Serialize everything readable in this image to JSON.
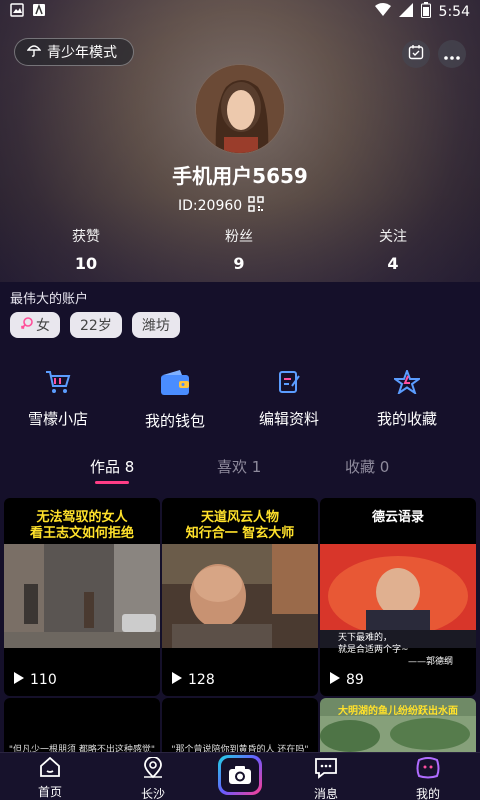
{
  "status_bar": {
    "time": "5:54"
  },
  "header": {
    "teen_mode_label": "青少年模式",
    "username": "手机用户5659",
    "user_id": "ID:20960",
    "stats": [
      {
        "label": "获赞",
        "value": "10"
      },
      {
        "label": "粉丝",
        "value": "9"
      },
      {
        "label": "关注",
        "value": "4"
      }
    ]
  },
  "profile": {
    "bio": "最伟大的账户",
    "tags": {
      "gender": "女",
      "age": "22岁",
      "city": "潍坊"
    }
  },
  "shortcuts": [
    {
      "label": "雪檬小店",
      "icon": "shopping-cart-icon"
    },
    {
      "label": "我的钱包",
      "icon": "wallet-icon"
    },
    {
      "label": "编辑资料",
      "icon": "edit-icon"
    },
    {
      "label": "我的收藏",
      "icon": "star-icon"
    }
  ],
  "tabs": [
    {
      "label": "作品 8"
    },
    {
      "label": "喜欢 1"
    },
    {
      "label": "收藏 0"
    }
  ],
  "videos": [
    {
      "title_line1": "无法驾驭的女人",
      "title_line2": "看王志文如何拒绝",
      "plays": "110"
    },
    {
      "title_line1": "天道风云人物",
      "title_line2": "知行合一  智玄大师",
      "plays": "128"
    },
    {
      "title_line1": "德云语录",
      "caption_line1": "天下最难的，",
      "caption_line2": "就是合适两个字~",
      "caption_author": "——郭德纲",
      "plays": "89"
    }
  ],
  "videos_row2": [
    {
      "caption": "\"但凡少一根朋须  都略不出这种感觉\""
    },
    {
      "caption": "\"那个曾说陪你到黄昏的人  还在吗\""
    },
    {
      "title": "大明湖的鱼儿纷纷跃出水面"
    }
  ],
  "bottom_nav": [
    {
      "label": "首页",
      "icon": "home-icon"
    },
    {
      "label": "长沙",
      "icon": "location-icon"
    },
    {
      "label": "消息",
      "icon": "message-icon"
    },
    {
      "label": "我的",
      "icon": "profile-icon"
    }
  ],
  "colors": {
    "accent": "#ff3d86",
    "background": "#15102a",
    "title_yellow": "#ffe12b"
  }
}
